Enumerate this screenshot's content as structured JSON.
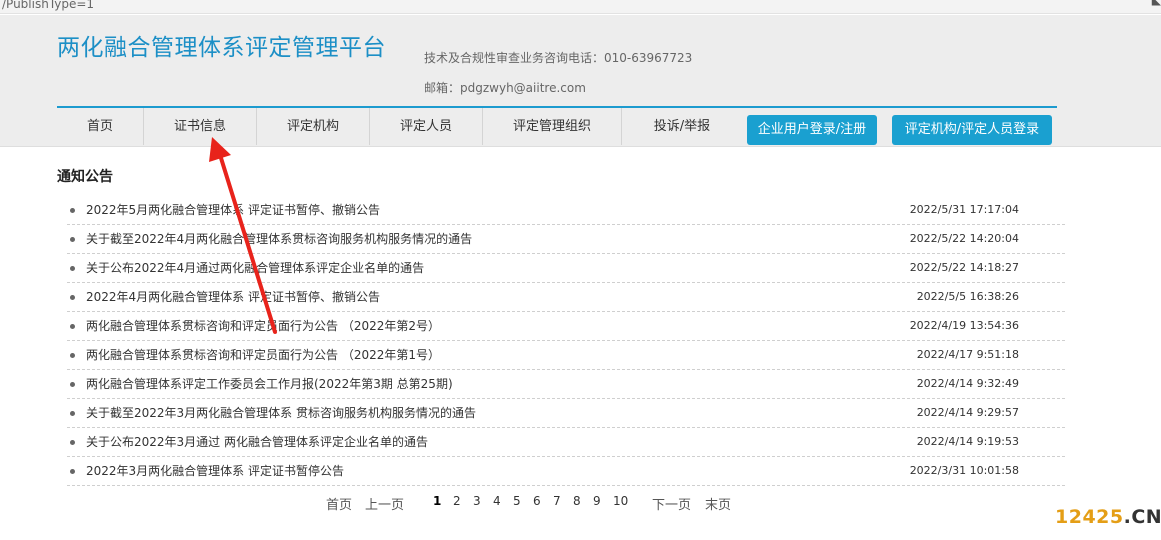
{
  "url_fragment": "/PublishType=1",
  "header": {
    "site_title": "两化融合管理体系评定管理平台",
    "phone": "技术及合规性审查业务咨询电话：010-63967723",
    "email": "邮箱：pdgzwyh@aiitre.com"
  },
  "nav": {
    "items": [
      "首页",
      "证书信息",
      "评定机构",
      "评定人员",
      "评定管理组织",
      "投诉/举报"
    ],
    "buttons": [
      "企业用户登录/注册",
      "评定机构/评定人员登录"
    ]
  },
  "notice": {
    "title": "通知公告",
    "items": [
      {
        "title": "2022年5月两化融合管理体系 评定证书暂停、撤销公告",
        "date": "2022/5/31 17:17:04"
      },
      {
        "title": "关于截至2022年4月两化融合管理体系贯标咨询服务机构服务情况的通告",
        "date": "2022/5/22 14:20:04"
      },
      {
        "title": "关于公布2022年4月通过两化融合管理体系评定企业名单的通告",
        "date": "2022/5/22 14:18:27"
      },
      {
        "title": "2022年4月两化融合管理体系 评定证书暂停、撤销公告",
        "date": "2022/5/5 16:38:26"
      },
      {
        "title": "两化融合管理体系贯标咨询和评定员面行为公告 （2022年第2号）",
        "date": "2022/4/19 13:54:36"
      },
      {
        "title": "两化融合管理体系贯标咨询和评定员面行为公告 （2022年第1号）",
        "date": "2022/4/17 9:51:18"
      },
      {
        "title": "两化融合管理体系评定工作委员会工作月报(2022年第3期 总第25期)",
        "date": "2022/4/14 9:32:49"
      },
      {
        "title": "关于截至2022年3月两化融合管理体系 贯标咨询服务机构服务情况的通告",
        "date": "2022/4/14 9:29:57"
      },
      {
        "title": "关于公布2022年3月通过 两化融合管理体系评定企业名单的通告",
        "date": "2022/4/14 9:19:53"
      },
      {
        "title": "2022年3月两化融合管理体系 评定证书暂停公告",
        "date": "2022/3/31 10:01:58"
      }
    ]
  },
  "pager": {
    "first": "首页",
    "prev": "上一页",
    "pages": [
      "1",
      "2",
      "3",
      "4",
      "5",
      "6",
      "7",
      "8",
      "9",
      "10"
    ],
    "current_page": "1",
    "next": "下一页",
    "last": "末页"
  },
  "watermark": {
    "number": "12425",
    "suffix": ".CN"
  },
  "colors": {
    "brand": "#1c8fc6",
    "button": "#1aa0d0",
    "arrow": "#e8231b",
    "watermark": "#e49e16"
  },
  "icons": {
    "annotation": "red-arrow-icon"
  }
}
